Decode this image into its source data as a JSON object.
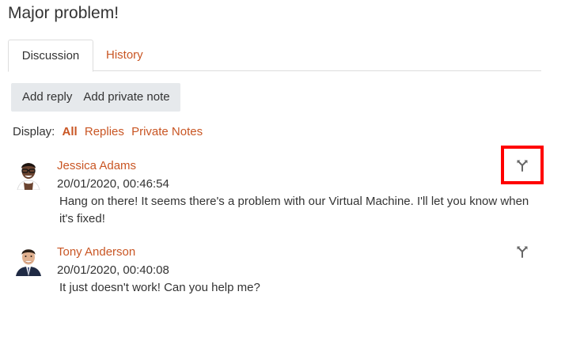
{
  "page": {
    "title": "Major problem!"
  },
  "tabs": [
    {
      "label": "Discussion",
      "active": true
    },
    {
      "label": "History",
      "active": false
    }
  ],
  "actions": {
    "add_reply": "Add reply",
    "add_private_note": "Add private note"
  },
  "display_filter": {
    "label": "Display:",
    "options": [
      {
        "label": "All",
        "active": true
      },
      {
        "label": "Replies",
        "active": false
      },
      {
        "label": "Private Notes",
        "active": false
      }
    ]
  },
  "messages": [
    {
      "author": "Jessica Adams",
      "timestamp": "20/01/2020, 00:46:54",
      "body": "Hang on there! It seems there's a problem with our Virtual Machine. I'll let you know when it's fixed!",
      "icon": "split-icon"
    },
    {
      "author": "Tony Anderson",
      "timestamp": "20/01/2020, 00:40:08",
      "body": "It just doesn't work! Can you help me?",
      "icon": "split-icon"
    }
  ],
  "colors": {
    "accent": "#c95624",
    "highlight": "#ff0000",
    "button_bg": "#e6e9ec"
  }
}
